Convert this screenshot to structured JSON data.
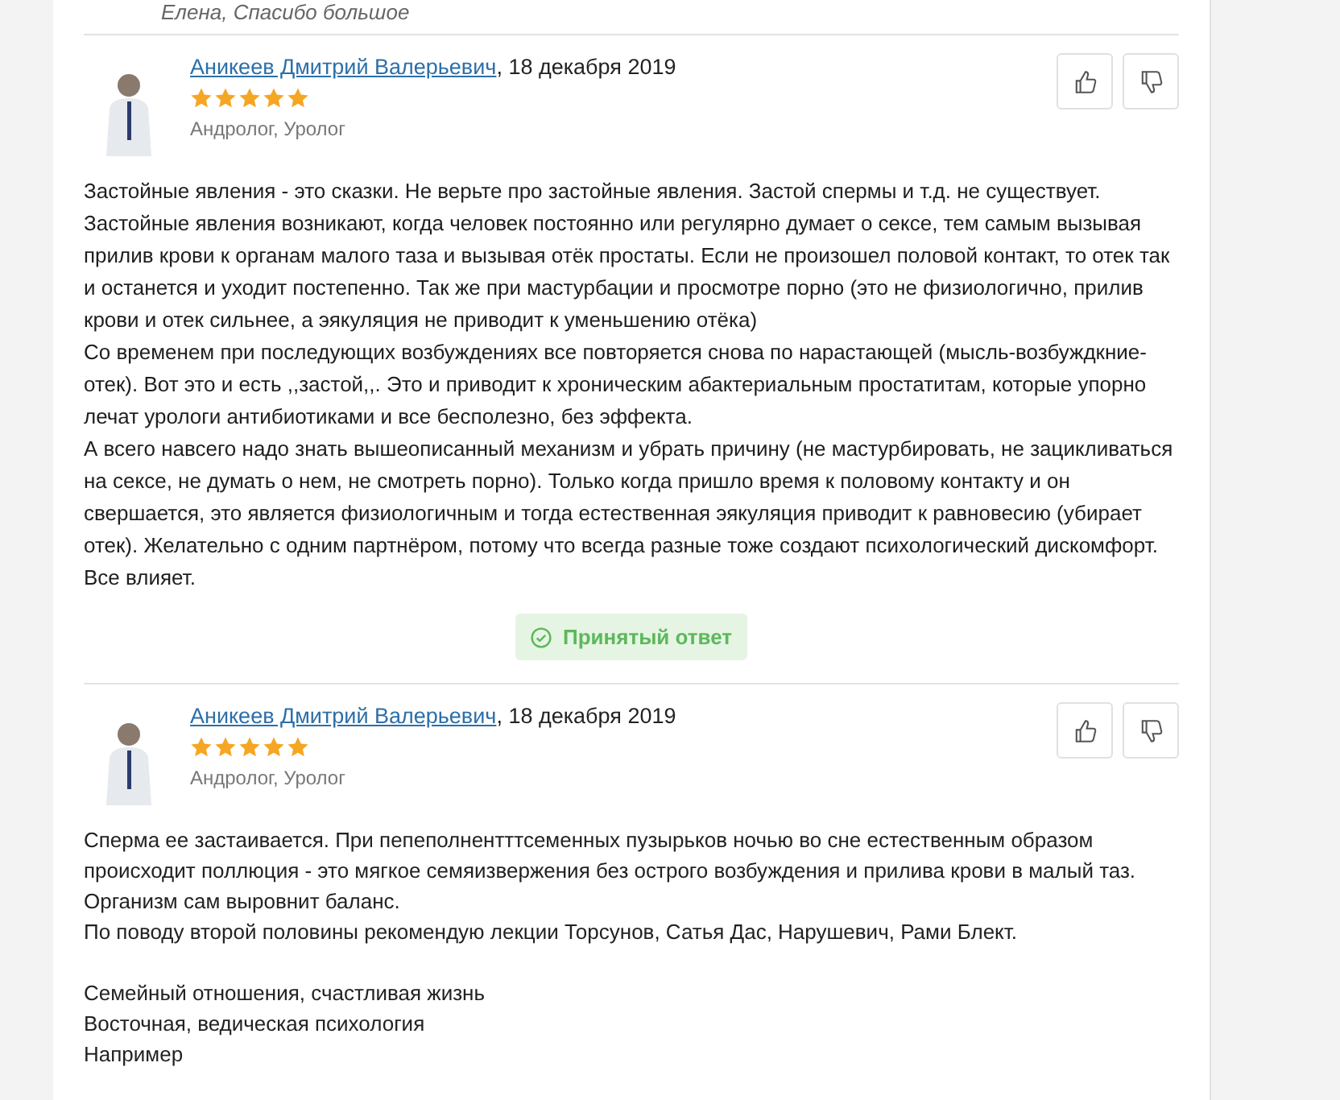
{
  "previous_comment": "Елена, Спасибо большое",
  "answers": [
    {
      "author": "Аникеев Дмитрий Валерьевич",
      "date": ", 18 декабря 2019",
      "stars": 5,
      "specialty": "Андролог, Уролог",
      "accepted": true,
      "accepted_label": "Принятый ответ",
      "blocks": [
        [
          "Застойные явления - это сказки. Не верьте про застойные явления. Застой спермы и т.д. не существует. Застойные явления возникают, когда человек постоянно или регулярно думает о сексе, тем самым вызывая прилив крови к органам малого таза и вызывая отёк простаты. Если не произошел половой контакт, то отек так и останется и уходит постепенно. Так же при мастурбации и просмотре порно (это не физиологично, прилив крови и отек сильнее, а эякуляция не приводит к уменьшению отёка)",
          "Со временем при последующих возбуждениях все повторяется снова по нарастающей (мысль-возбуждкние-отек). Вот это и есть ,,застой,,. Это и приводит к хроническим абактериальным простатитам, которые упорно лечат урологи антибиотиками и все бесполезно, без эффекта.",
          "А всего навсего надо знать вышеописанный механизм и убрать причину (не мастурбировать, не зацикливаться на сексе, не думать о нем, не смотреть порно). Только когда пришло время к половому контакту и он свершается, это является физиологичным и тогда естественная эякуляция приводит к равновесию (убирает отек). Желательно с одним партнёром, потому что всегда разные тоже создают психологический дискомфорт. Все влияет."
        ]
      ]
    },
    {
      "author": "Аникеев Дмитрий Валерьевич",
      "date": ", 18 декабря 2019",
      "stars": 5,
      "specialty": "Андролог, Уролог",
      "accepted": false,
      "blocks": [
        [
          "Сперма ее застаивается. При пепеполнентттсеменных пузырьков ночью во сне естественным образом происходит поллюция - это мягкое семяизвержения без острого возбуждения и прилива крови в малый таз.",
          "Организм сам выровнит баланс.",
          "По поводу второй половины рекомендую лекции Торсунов, Сатья Дас, Нарушевич, Рами Блект."
        ],
        [
          "Семейный отношения, счастливая жизнь",
          "Восточная, ведическая психология",
          "Например"
        ]
      ]
    }
  ]
}
